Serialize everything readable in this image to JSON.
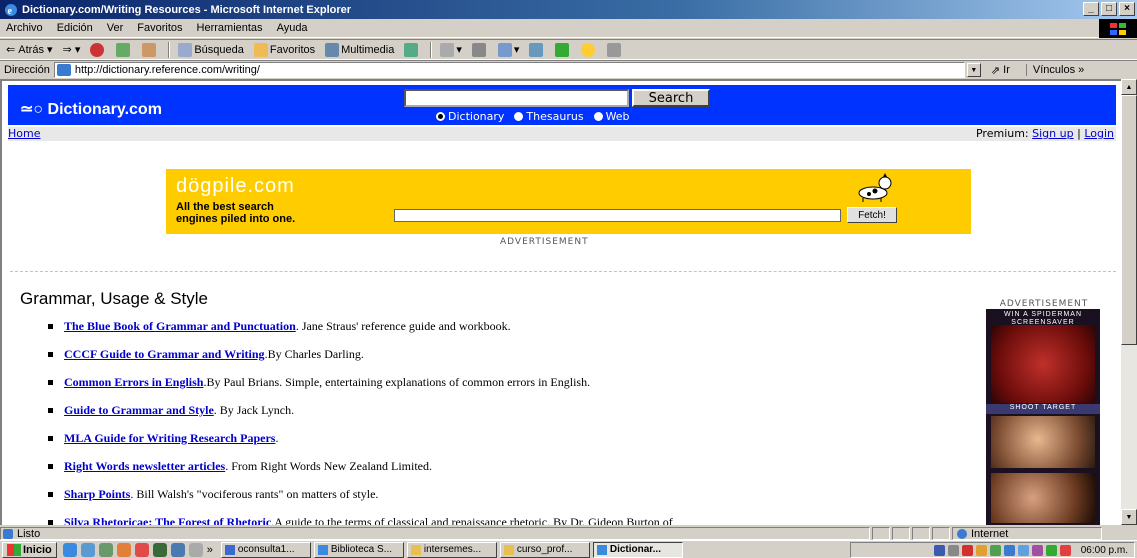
{
  "window": {
    "title": "Dictionary.com/Writing Resources - Microsoft Internet Explorer",
    "btn_min": "_",
    "btn_max": "□",
    "btn_close": "×"
  },
  "menu": [
    "Archivo",
    "Edición",
    "Ver",
    "Favoritos",
    "Herramientas",
    "Ayuda"
  ],
  "toolbar": {
    "back": "Atrás",
    "search": "Búsqueda",
    "favorites": "Favoritos",
    "multimedia": "Multimedia"
  },
  "address": {
    "label": "Dirección",
    "url": "http://dictionary.reference.com/writing/",
    "go": "Ir",
    "links": "Vínculos »"
  },
  "site": {
    "logo": "≃○ Dictionary.com",
    "search_button": "Search",
    "radio_dictionary": "Dictionary",
    "radio_thesaurus": "Thesaurus",
    "radio_web": "Web",
    "home_link": "Home",
    "premium_label": "Premium:",
    "signup_link": "Sign up",
    "separator": "|",
    "login_link": "Login"
  },
  "dogpile": {
    "logo": "dögpile.com",
    "tagline1": "All the best search",
    "tagline2": "engines piled into one.",
    "fetch_button": "Fetch!",
    "ad_label": "ADVERTISEMENT"
  },
  "content": {
    "heading": "Grammar, Usage & Style",
    "items": [
      {
        "link": "The Blue Book of Grammar and Punctuation",
        "desc": ". Jane Straus' reference guide and workbook."
      },
      {
        "link": "CCCF Guide to Grammar and Writing",
        "desc": ".By Charles Darling."
      },
      {
        "link": "Common Errors in English",
        "desc": ".By Paul Brians. Simple, entertaining explanations of common errors in English."
      },
      {
        "link": "Guide to Grammar and Style",
        "desc": ". By Jack Lynch."
      },
      {
        "link": "MLA Guide for Writing Research Papers",
        "desc": "."
      },
      {
        "link": "Right Words newsletter articles",
        "desc": ". From Right Words New Zealand Limited."
      },
      {
        "link": "Sharp Points",
        "desc": ". Bill Walsh's \"vociferous rants\" on matters of style."
      },
      {
        "link": "Silva Rhetoricae: The Forest of Rhetoric",
        "desc": ".A guide to the terms of classical and renaissance rhetoric. By Dr. Gideon Burton of"
      }
    ]
  },
  "side_ad": {
    "label": "ADVERTISEMENT",
    "banner_line1": "WIN A SPIDERMAN",
    "banner_line2": "SCREENSAVER",
    "shoot": "SHOOT TARGET"
  },
  "status": {
    "text": "Listo",
    "zone": "Internet"
  },
  "taskbar": {
    "start": "Inicio",
    "chevron": "»",
    "tasks": [
      "oconsulta1...",
      "Biblioteca S...",
      "intersemes...",
      "curso_prof...",
      "Dictionar..."
    ],
    "clock": "06:00 p.m."
  },
  "colors": {
    "site_blue": "#0033ff",
    "dogpile_yellow": "#ffcc00",
    "link": "#0000cc"
  }
}
